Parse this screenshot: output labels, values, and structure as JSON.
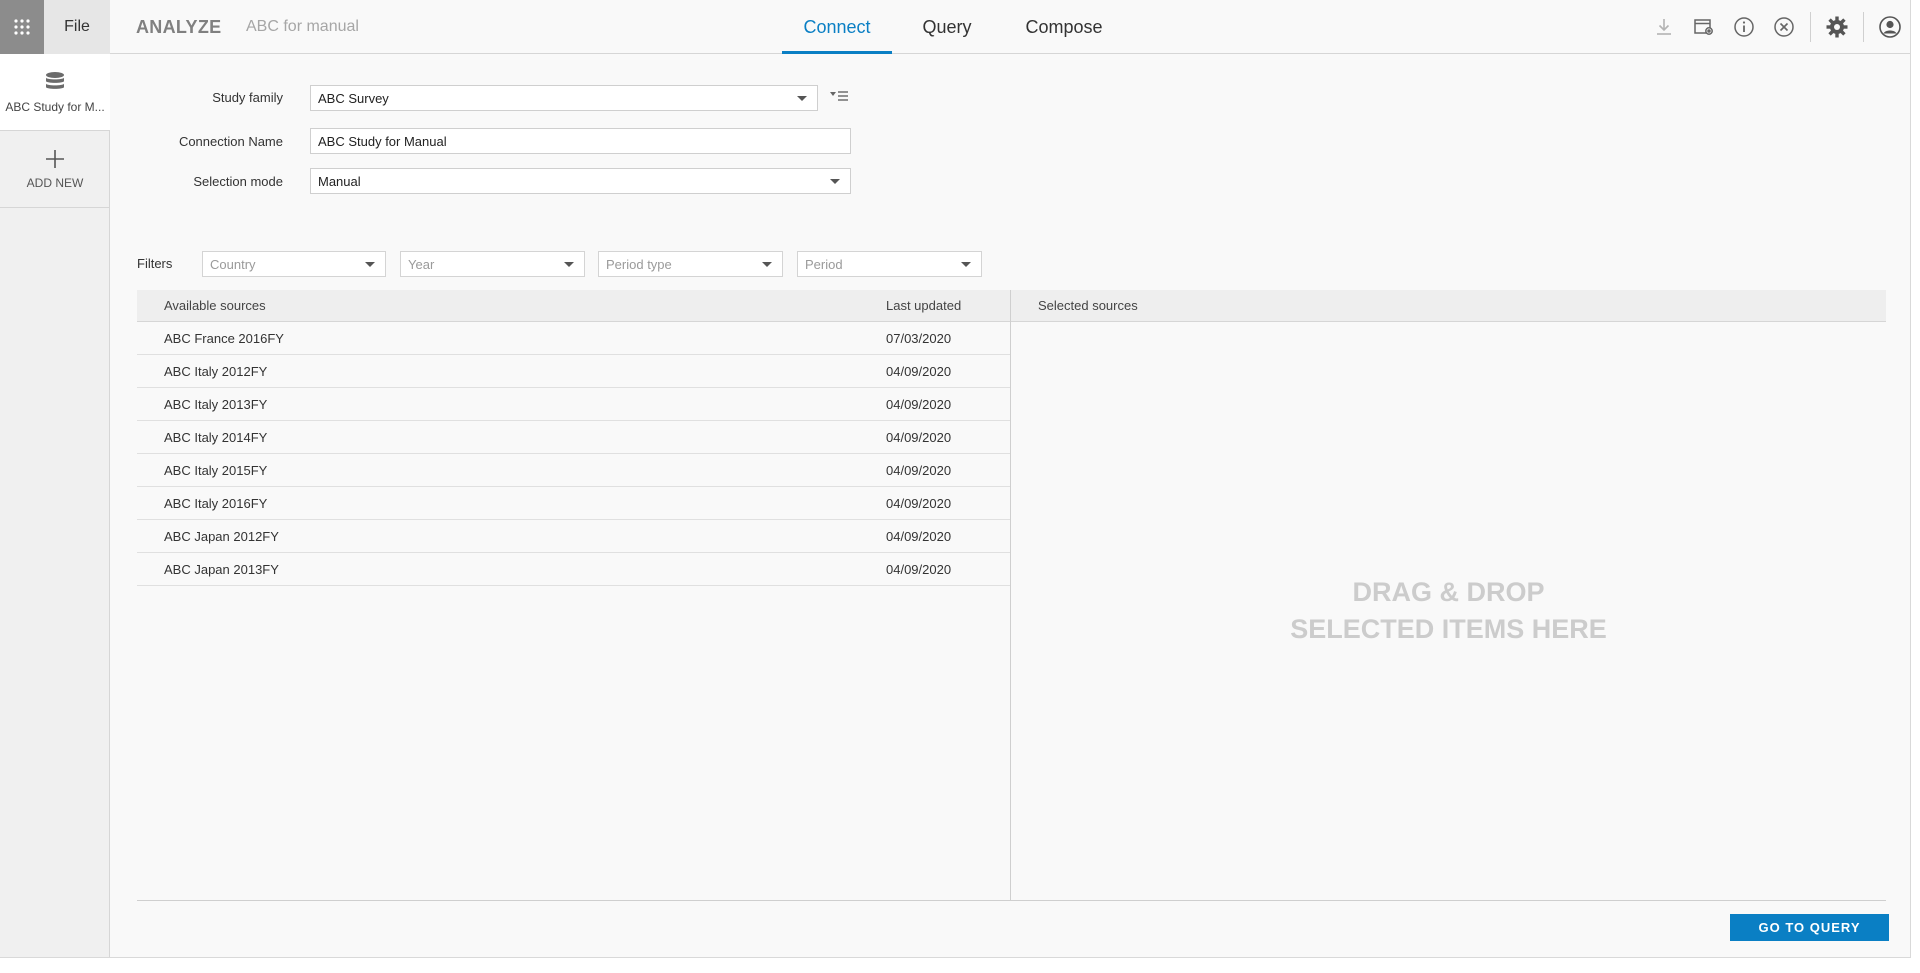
{
  "topbar": {
    "apps_icon": "grid-icon",
    "file_label": "File",
    "brand": "ANALYZE",
    "project_name": "ABC for manual",
    "tabs": [
      {
        "label": "Connect",
        "active": true
      },
      {
        "label": "Query",
        "active": false
      },
      {
        "label": "Compose",
        "active": false
      }
    ],
    "icons": [
      "download-icon",
      "folder-settings-icon",
      "info-icon",
      "close-circle-icon",
      "gear-icon",
      "user-icon"
    ]
  },
  "rail": {
    "items": [
      {
        "label": "ABC Study for M...",
        "icon": "database-icon"
      },
      {
        "label": "ADD NEW",
        "icon": "plus-icon"
      }
    ]
  },
  "form": {
    "study_family": {
      "label": "Study family",
      "value": "ABC Survey"
    },
    "connection_name": {
      "label": "Connection Name",
      "value": "ABC Study for Manual"
    },
    "selection_mode": {
      "label": "Selection mode",
      "value": "Manual"
    }
  },
  "filters": {
    "label": "Filters",
    "items": [
      {
        "placeholder": "Country"
      },
      {
        "placeholder": "Year"
      },
      {
        "placeholder": "Period type"
      },
      {
        "placeholder": "Period"
      }
    ]
  },
  "available": {
    "header_name": "Available sources",
    "header_date": "Last updated",
    "rows": [
      {
        "name": "ABC France 2016FY",
        "date": "07/03/2020"
      },
      {
        "name": "ABC Italy 2012FY",
        "date": "04/09/2020"
      },
      {
        "name": "ABC Italy 2013FY",
        "date": "04/09/2020"
      },
      {
        "name": "ABC Italy 2014FY",
        "date": "04/09/2020"
      },
      {
        "name": "ABC Italy 2015FY",
        "date": "04/09/2020"
      },
      {
        "name": "ABC Italy 2016FY",
        "date": "04/09/2020"
      },
      {
        "name": "ABC Japan 2012FY",
        "date": "04/09/2020"
      },
      {
        "name": "ABC Japan 2013FY",
        "date": "04/09/2020"
      }
    ]
  },
  "selected": {
    "header": "Selected sources",
    "dropzone_text": "DRAG & DROP\nSELECTED ITEMS HERE"
  },
  "actions": {
    "go_to_query": "GO TO QUERY"
  },
  "colors": {
    "accent": "#0a7fc4",
    "apps_button": "#8c8c8c"
  }
}
